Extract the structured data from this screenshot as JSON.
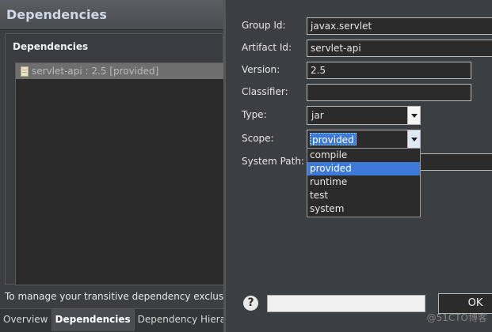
{
  "editor": {
    "title": "Dependencies",
    "section_title": "Dependencies",
    "dependency_items": [
      {
        "label": "servlet-api : 2.5 [provided]",
        "icon": "jar-icon"
      }
    ],
    "hint": "To manage your transitive dependency exclusio",
    "tabs": [
      {
        "label": "Overview",
        "active": false
      },
      {
        "label": "Dependencies",
        "active": true
      },
      {
        "label": "Dependency Hierarc",
        "active": false
      }
    ]
  },
  "dialog": {
    "labels": {
      "group_id": "Group Id:",
      "artifact_id": "Artifact Id:",
      "version": "Version:",
      "classifier": "Classifier:",
      "type": "Type:",
      "scope": "Scope:",
      "system_path": "System Path:"
    },
    "values": {
      "group_id": "javax.servlet",
      "artifact_id": "servlet-api",
      "version": "2.5",
      "classifier": "",
      "type": "jar",
      "scope": "provided",
      "system_path": ""
    },
    "scope_options": [
      "compile",
      "provided",
      "runtime",
      "test",
      "system"
    ],
    "scope_selected": "provided",
    "help_icon": "?",
    "ok_label": "OK"
  },
  "watermark": "@51CTO博客",
  "colors": {
    "selection": "#3d79d6",
    "panel": "#3c3f41",
    "field_bg": "#2b2b2b"
  }
}
